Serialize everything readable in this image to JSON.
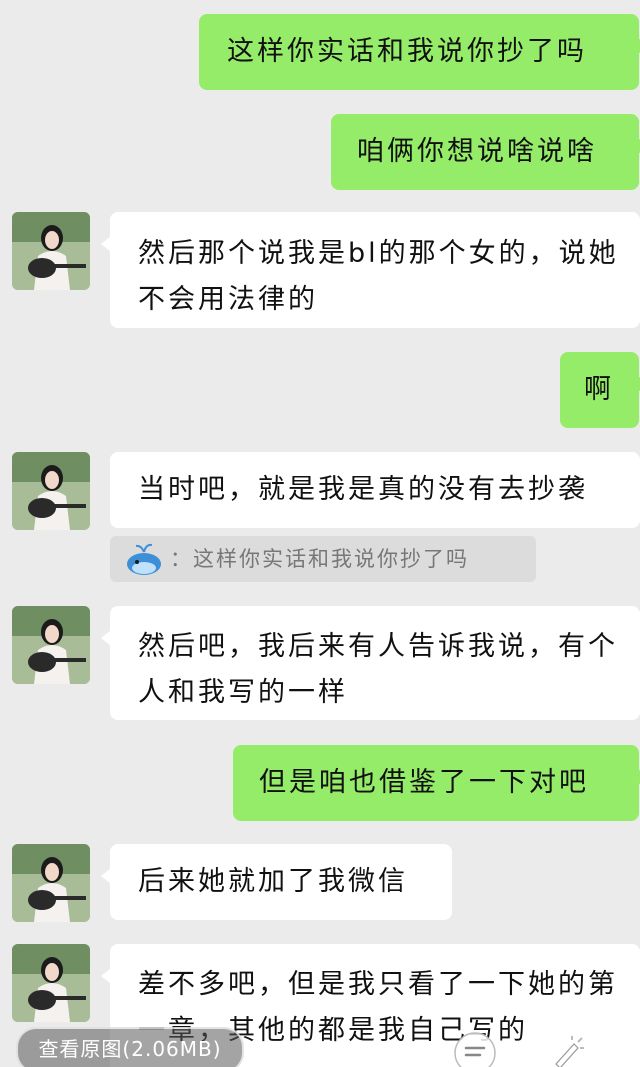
{
  "messages": [
    {
      "side": "me",
      "text": "这样你实话和我说你抄了吗"
    },
    {
      "side": "me",
      "text": "咱俩你想说啥说啥"
    },
    {
      "side": "other",
      "text": "然后那个说我是bl的那个女的，说她不会用法律的"
    },
    {
      "side": "me",
      "text": "啊"
    },
    {
      "side": "other",
      "text": "当时吧，就是我是真的没有去抄袭"
    },
    {
      "side": "other",
      "text": "然后吧，我后来有人告诉我说，有个人和我写的一样"
    },
    {
      "side": "me",
      "text": "但是咱也借鉴了一下对吧"
    },
    {
      "side": "other",
      "text": "后来她就加了我微信"
    },
    {
      "side": "other",
      "text": "差不多吧，但是我只看了一下她的第一章，其他的都是我自己写的"
    }
  ],
  "quote": {
    "author_icon": "whale-avatar-icon",
    "text": "：这样你实话和我说你抄了吗"
  },
  "footer": {
    "view_original_label": "查看原图(2.06MB)",
    "icons": [
      "menu-icon",
      "edit-icon"
    ]
  },
  "colors": {
    "background": "#ebebeb",
    "my_bubble": "#95ec69",
    "other_bubble": "#ffffff"
  }
}
